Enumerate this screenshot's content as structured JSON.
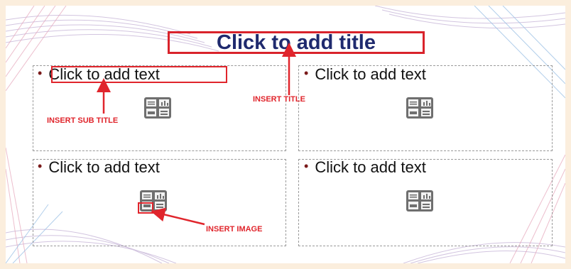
{
  "slide": {
    "title": "Click to add title",
    "placeholders": [
      {
        "text": "Click to add text"
      },
      {
        "text": "Click to add text"
      },
      {
        "text": "Click to add text"
      },
      {
        "text": "Click to add text"
      }
    ]
  },
  "annotations": {
    "insert_title": "INSERT TITLE",
    "insert_sub_title": "INSERT SUB TITLE",
    "insert_image": "INSERT IMAGE"
  },
  "colors": {
    "title_text": "#1f2a6e",
    "annotation_red": "#e0252c",
    "bullet": "#7a1a1a"
  },
  "icons": {
    "content_placeholder": "insert-content-icon",
    "bullet": "bullet-icon"
  }
}
